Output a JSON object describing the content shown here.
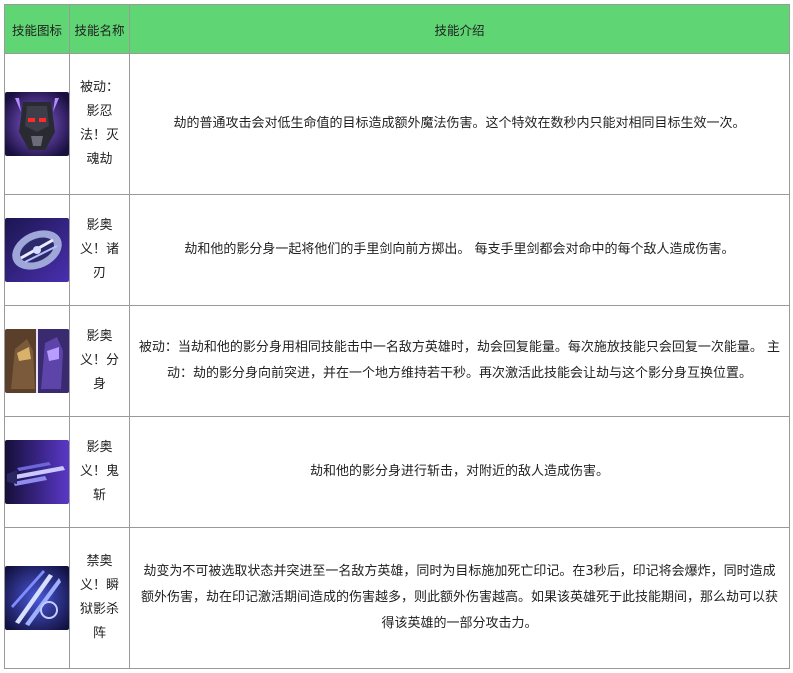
{
  "table": {
    "headers": [
      "技能图标",
      "技能名称",
      "技能介绍"
    ],
    "rows": [
      {
        "icon": "shadow-mask-icon",
        "name": "被动：影忍法！灭魂劫",
        "desc": "劫的普通攻击会对低生命值的目标造成额外魔法伤害。这个特效在数秒内只能对相同目标生效一次。"
      },
      {
        "icon": "shuriken-icon",
        "name": "影奥义！诸刃",
        "desc": "劫和他的影分身一起将他们的手里剑向前方掷出。  每支手里剑都会对命中的每个敌人造成伤害。"
      },
      {
        "icon": "shadow-clone-icon",
        "name": "影奥义！分身",
        "desc": "被动：当劫和他的影分身用相同技能击中一名敌方英雄时，劫会回复能量。每次施放技能只会回复一次能量。  主动：劫的影分身向前突进，并在一个地方维持若干秒。再次激活此技能会让劫与这个影分身互换位置。"
      },
      {
        "icon": "blade-slash-icon",
        "name": "影奥义！鬼斩",
        "desc": "劫和他的影分身进行斩击，对附近的敌人造成伤害。"
      },
      {
        "icon": "death-mark-icon",
        "name": "禁奥义！瞬狱影杀阵",
        "desc": "劫变为不可被选取状态并突进至一名敌方英雄，同时为目标施加死亡印记。在3秒后，印记将会爆炸，同时造成额外伤害，劫在印记激活期间造成的伤害越多，则此额外伤害越高。如果该英雄死于此技能期间，那么劫可以获得该英雄的一部分攻击力。"
      }
    ]
  }
}
